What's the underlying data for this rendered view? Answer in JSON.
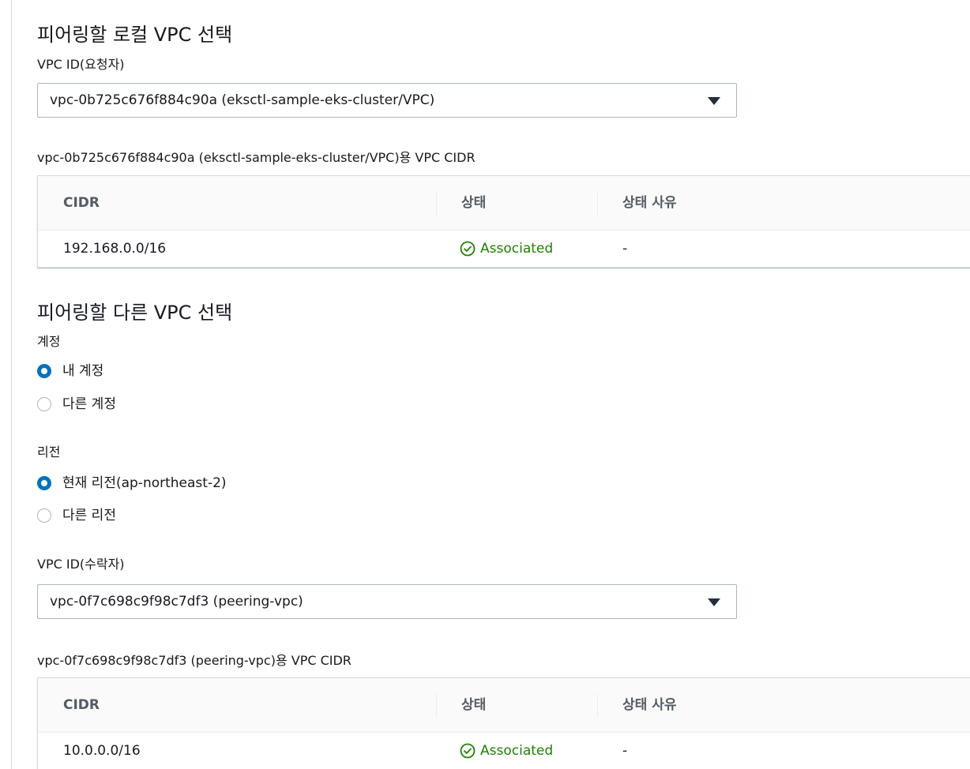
{
  "local": {
    "title": "피어링할 로컬 VPC 선택",
    "vpc_id_label": "VPC ID(요청자)",
    "vpc_select_value": "vpc-0b725c676f884c90a (eksctl-sample-eks-cluster/VPC)",
    "cidr_caption": "vpc-0b725c676f884c90a (eksctl-sample-eks-cluster/VPC)용 VPC CIDR",
    "table": {
      "headers": [
        "CIDR",
        "상태",
        "상태 사유"
      ],
      "rows": [
        {
          "cidr": "192.168.0.0/16",
          "status": "Associated",
          "reason": "-"
        }
      ]
    }
  },
  "peer": {
    "title": "피어링할 다른 VPC 선택",
    "account_label": "계정",
    "account_options": [
      {
        "label": "내 계정",
        "checked": true
      },
      {
        "label": "다른 계정",
        "checked": false
      }
    ],
    "region_label": "리전",
    "region_options": [
      {
        "label": "현재 리전(ap-northeast-2)",
        "checked": true
      },
      {
        "label": "다른 리전",
        "checked": false
      }
    ],
    "vpc_id_label": "VPC ID(수락자)",
    "vpc_select_value": "vpc-0f7c698c9f98c7df3 (peering-vpc)",
    "cidr_caption": "vpc-0f7c698c9f98c7df3 (peering-vpc)용 VPC CIDR",
    "table": {
      "headers": [
        "CIDR",
        "상태",
        "상태 사유"
      ],
      "rows": [
        {
          "cidr": "10.0.0.0/16",
          "status": "Associated",
          "reason": "-"
        }
      ]
    }
  },
  "icons": {
    "status_icon": "check-circle-icon",
    "dropdown_icon": "caret-down-icon"
  },
  "colors": {
    "success": "#1d8102",
    "radio_selected": "#0073bb"
  }
}
